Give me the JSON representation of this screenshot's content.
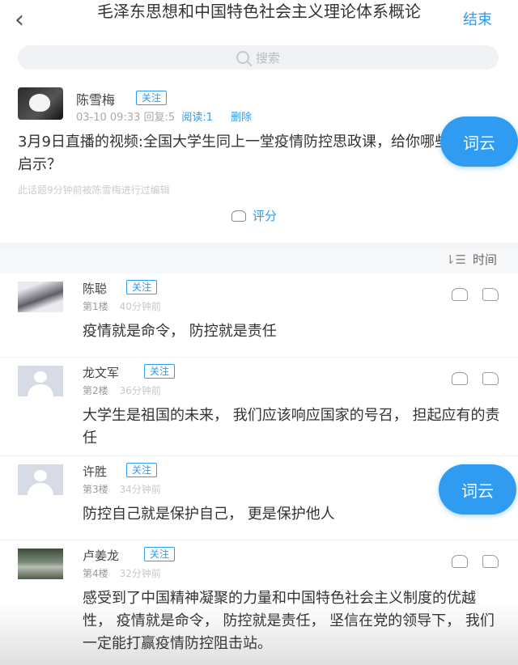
{
  "header": {
    "back_icon": "chevron-left-icon",
    "title": "毛泽东思想和中国特色社会主义理论体系概论",
    "end_label": "结束"
  },
  "search": {
    "placeholder": "搜索",
    "icon": "search-icon"
  },
  "post": {
    "author": "陈雪梅",
    "follow": "关注",
    "time": "03-10 09:33",
    "replies": "回复:5",
    "reads": "阅读:1",
    "delete": "删除",
    "title": "3月9日直播的视频:全国大学生同上一堂疫情防控思政课，给你哪些启示？",
    "edit_note": "此话题9分钟前被陈雪梅进行过编辑",
    "rate_label": "评分"
  },
  "sort": {
    "label": "时间"
  },
  "word_cloud_label": "词云",
  "comments": [
    {
      "name": "陈聪",
      "follow": "关注",
      "floor": "第1楼",
      "ago": "40分钟前",
      "text": "疫情就是命令， 防控就是责任"
    },
    {
      "name": "龙文军",
      "follow": "关注",
      "floor": "第2楼",
      "ago": "36分钟前",
      "text": "大学生是祖国的未来， 我们应该响应国家的号召， 担起应有的责任"
    },
    {
      "name": "许胜",
      "follow": "关注",
      "floor": "第3楼",
      "ago": "34分钟前",
      "text": "防控自己就是保护自己， 更是保护他人"
    },
    {
      "name": "卢姜龙",
      "follow": "关注",
      "floor": "第4楼",
      "ago": "32分钟前",
      "text": "感受到了中国精神凝聚的力量和中国特色社会主义制度的优越性， 疫情就是命令， 防控就是责任， 坚信在党的领导下， 我们一定能打赢疫情防控阻击站。"
    }
  ],
  "colors": {
    "accent": "#2d9bf0",
    "word_cloud_bg": "#2f9cf2"
  }
}
